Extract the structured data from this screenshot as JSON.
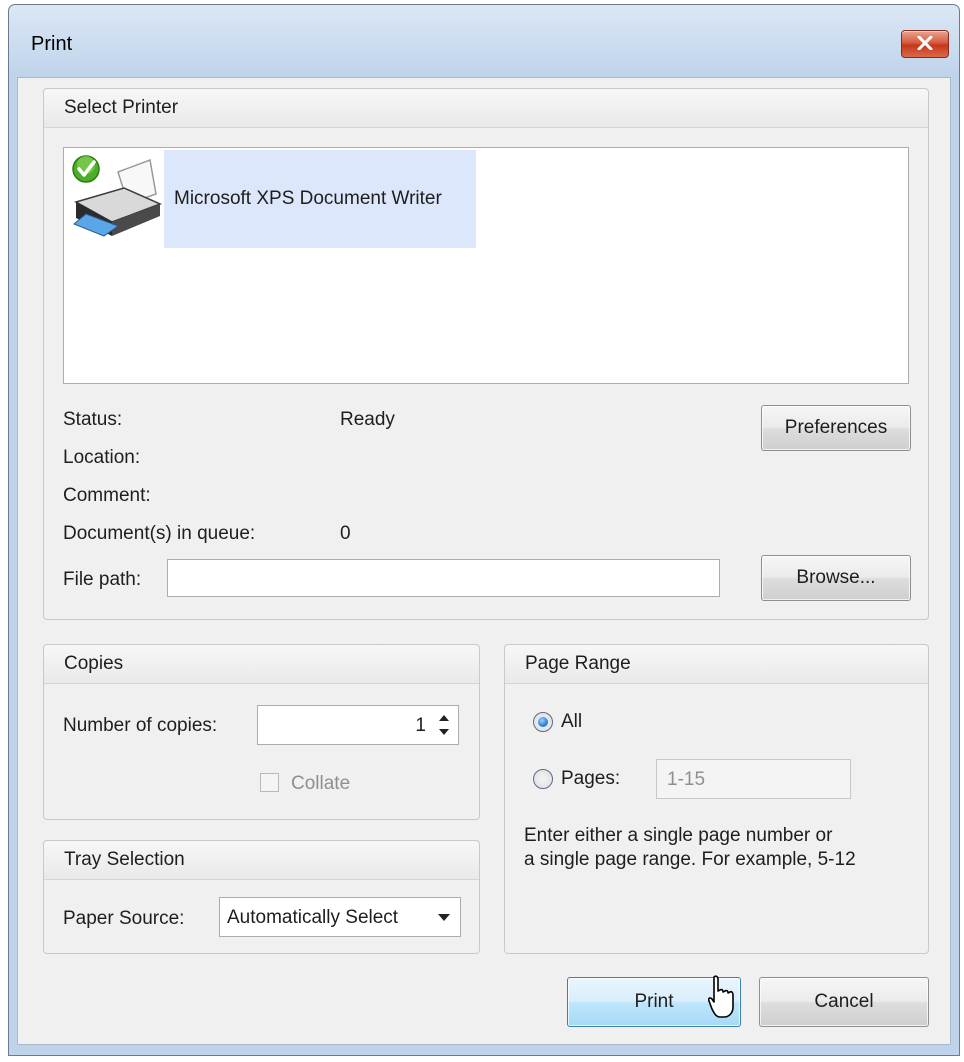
{
  "window": {
    "title": "Print"
  },
  "select_printer": {
    "header": "Select Printer",
    "printers": [
      {
        "name": "Microsoft XPS Document Writer",
        "icon": "printer-default-icon"
      }
    ],
    "status_label": "Status:",
    "status_value": "Ready",
    "location_label": "Location:",
    "comment_label": "Comment:",
    "queue_label": "Document(s) in queue:",
    "queue_value": "0",
    "filepath_label": "File path:",
    "filepath_value": "",
    "preferences_button": "Preferences",
    "browse_button": "Browse..."
  },
  "copies": {
    "header": "Copies",
    "number_label": "Number of copies:",
    "number_value": "1",
    "collate_label": "Collate",
    "collate_checked": false
  },
  "tray": {
    "header": "Tray Selection",
    "paper_source_label": "Paper Source:",
    "paper_source_value": "Automatically Select"
  },
  "page_range": {
    "header": "Page Range",
    "all_label": "All",
    "pages_label": "Pages:",
    "pages_value": "1-15",
    "selected": "All",
    "hint_line1": "Enter either a single page number or",
    "hint_line2": "a single page range. For example, 5-12"
  },
  "actions": {
    "print_button": "Print",
    "cancel_button": "Cancel"
  },
  "colors": {
    "titlebar": "#c9dbef",
    "close_button": "#c6371b",
    "selection": "#dde7fb",
    "default_button": "#bee6fd"
  }
}
